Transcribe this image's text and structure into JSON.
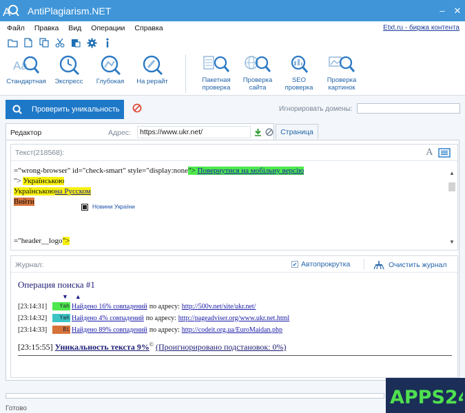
{
  "window": {
    "title": "AntiPlagiarism.NET",
    "minimize": "–",
    "close": "✕"
  },
  "menu": {
    "items": [
      "Файл",
      "Правка",
      "Вид",
      "Операции",
      "Справка"
    ],
    "right_link": "Etxt.ru - биржа контента"
  },
  "small_toolbar": {
    "icons": [
      "folder-open-icon",
      "new-document-icon",
      "copy-icon",
      "cut-icon",
      "paste-icon",
      "settings-icon",
      "info-icon"
    ]
  },
  "check_tools": [
    {
      "label": "Стандартная"
    },
    {
      "label": "Экспресс"
    },
    {
      "label": "Глубокая"
    },
    {
      "label": "На рерайт"
    }
  ],
  "batch_tools": [
    {
      "label_1": "Пакетная",
      "label_2": "проверка"
    },
    {
      "label_1": "Проверка",
      "label_2": "сайта"
    },
    {
      "label_1": "SEO",
      "label_2": "проверка"
    },
    {
      "label_1": "Проверка",
      "label_2": "картинок"
    }
  ],
  "actions": {
    "check_button": "Проверить уникальность",
    "ignore_label": "Игнорировать домены:",
    "ignore_value": ""
  },
  "tabs": {
    "editor": "Редактор",
    "address_label": "Адрес:",
    "address_value": "https://www.ukr.net/",
    "page": "Страница"
  },
  "editor": {
    "counter": "Текст(218568):",
    "font_icon": "A",
    "line1_prefix": "=\"wrong-browser\" id=\"check-smart\" style=\"display:none",
    "line1_highlight": "\"> ",
    "line1_link": "Повернутися на мобільну версію",
    "line2_prefix": "\"> ",
    "line2_text": "Українською",
    "line3_text": "Українською",
    "line3_link": "на Русском",
    "line4_text": "Вийти",
    "news_label": "Новини України",
    "line5_prefix": "=\"header__logo",
    "line5_highlight": "\">"
  },
  "journal": {
    "label": "Журнал:",
    "autoscroll": "Автопрокрутка",
    "autoscroll_checked": true,
    "clear": "Очистить журнал",
    "operation": "Операция поиска #1",
    "arrow_down": "▼",
    "arrow_up": "▲",
    "entries": [
      {
        "time": "[23:14:31]",
        "tag": "Yah",
        "found": "Найдено 16% совпадений",
        "mid": "по адресу:",
        "url": "http://500v.net/site/ukr.net/",
        "color": "#4ee84e"
      },
      {
        "time": "[23:14:32]",
        "tag": "Yah",
        "found": "Найдено 4% совпадений",
        "mid": "по адресу:",
        "url": "http://pageadviser.org/www.ukr.net.html",
        "color": "#3cc4c4"
      },
      {
        "time": "[23:14:33]",
        "tag": "Bi",
        "found": "Найдено 89% совпадений",
        "mid": "по адресу:",
        "url": "http://codeit.org.ua/EuroMaidan.php",
        "color": "#d6733a"
      }
    ],
    "summary_time": "[23:15:55]",
    "summary_uniqueness": "Уникальность текста 9%",
    "summary_mark": "©",
    "summary_ignored": "(Проигнорировано подстановок: 0%)"
  },
  "status": {
    "text": "Готово",
    "progress": 0
  },
  "watermark": {
    "text": "APPS24"
  },
  "colors": {
    "titlebar": "#3f95d8",
    "accent": "#1e78c8",
    "link": "#2364a8"
  }
}
